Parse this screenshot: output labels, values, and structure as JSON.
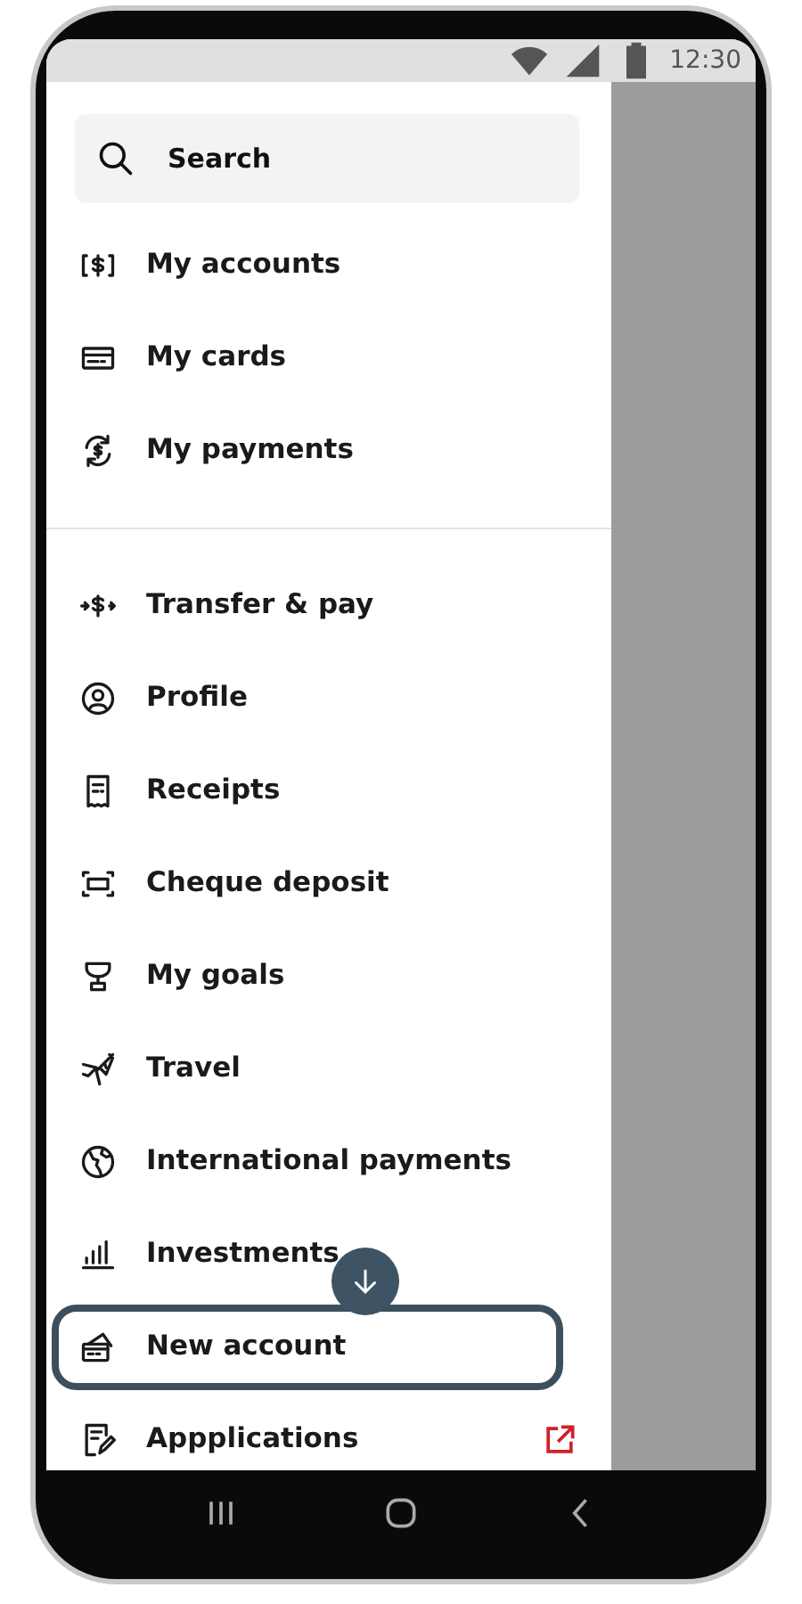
{
  "status_bar": {
    "time": "12:30"
  },
  "search": {
    "placeholder": "Search"
  },
  "menu_sections": [
    {
      "items": [
        {
          "label": "My accounts",
          "highlighted": false,
          "external": false
        },
        {
          "label": "My cards",
          "highlighted": false,
          "external": false
        },
        {
          "label": "My payments",
          "highlighted": false,
          "external": false
        }
      ]
    },
    {
      "items": [
        {
          "label": "Transfer & pay",
          "highlighted": false,
          "external": false
        },
        {
          "label": "Profile",
          "highlighted": false,
          "external": false
        },
        {
          "label": "Receipts",
          "highlighted": false,
          "external": false
        },
        {
          "label": "Cheque deposit",
          "highlighted": false,
          "external": false
        },
        {
          "label": "My goals",
          "highlighted": false,
          "external": false
        },
        {
          "label": "Travel",
          "highlighted": false,
          "external": false
        },
        {
          "label": "International payments",
          "highlighted": false,
          "external": false
        },
        {
          "label": "Investments",
          "highlighted": false,
          "external": false
        },
        {
          "label": "New account",
          "highlighted": true,
          "external": false
        },
        {
          "label": "Appplications",
          "highlighted": false,
          "external": true
        }
      ]
    }
  ]
}
